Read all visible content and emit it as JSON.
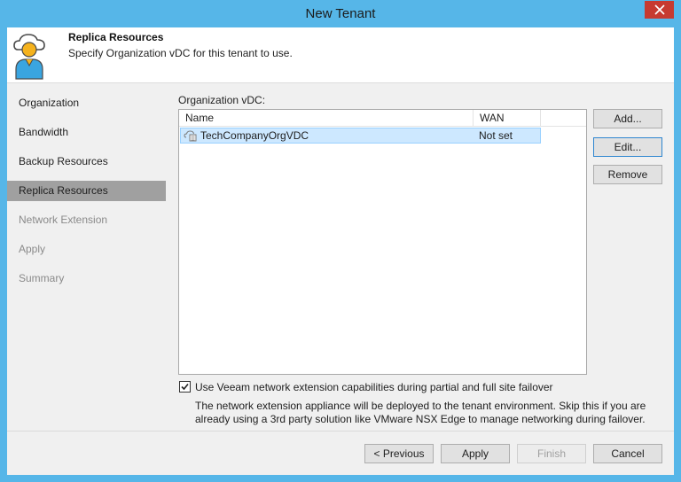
{
  "window": {
    "title": "New Tenant"
  },
  "header": {
    "title": "Replica Resources",
    "subtitle": "Specify Organization vDC for this tenant to use.",
    "icon": "cloud-user-icon"
  },
  "steps": [
    {
      "label": "Organization",
      "state": "done"
    },
    {
      "label": "Bandwidth",
      "state": "done"
    },
    {
      "label": "Backup Resources",
      "state": "done"
    },
    {
      "label": "Replica Resources",
      "state": "active"
    },
    {
      "label": "Network Extension",
      "state": "disabled"
    },
    {
      "label": "Apply",
      "state": "disabled"
    },
    {
      "label": "Summary",
      "state": "disabled"
    }
  ],
  "main": {
    "section_label": "Organization vDC:",
    "columns": [
      "Name",
      "WAN"
    ],
    "rows": [
      {
        "name": "TechCompanyOrgVDC",
        "wan": "Not set",
        "icon": "org-vdc-icon",
        "selected": true
      }
    ],
    "buttons": {
      "add": "Add...",
      "edit": "Edit...",
      "remove": "Remove"
    },
    "checkbox": {
      "checked": true,
      "label": "Use Veeam network extension capabilities during partial and full site failover"
    },
    "note_line1": "The network extension appliance will be deployed to the tenant environment. Skip this if you are",
    "note_line2": "already using a 3rd party solution like VMware NSX Edge to manage networking during failover."
  },
  "footer": {
    "previous": "< Previous",
    "apply": "Apply",
    "finish": "Finish",
    "cancel": "Cancel"
  },
  "colors": {
    "title_bar": "#56b6e8",
    "close_button": "#c73a30",
    "selection": "#cde8ff",
    "active_step": "#a0a0a0"
  }
}
